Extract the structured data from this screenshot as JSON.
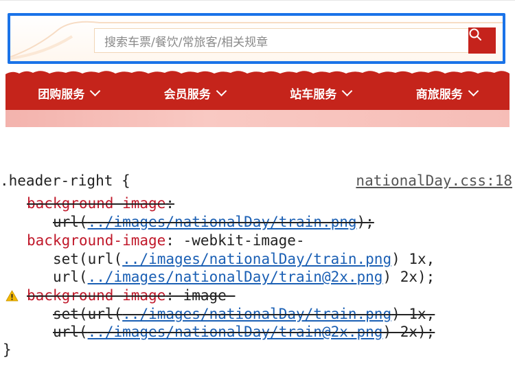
{
  "header": {
    "search_placeholder": "搜索车票/餐饮/常旅客/相关规章"
  },
  "nav": {
    "items": [
      {
        "label": "团购服务"
      },
      {
        "label": "会员服务"
      },
      {
        "label": "站车服务"
      },
      {
        "label": "商旅服务"
      }
    ]
  },
  "styles": {
    "selector": ".header-right",
    "open_brace": "{",
    "close_brace": "}",
    "source": "nationalDay.css:18",
    "rules": [
      {
        "prop": "background-image",
        "sep": ":",
        "overridden": true,
        "warning": false
      },
      {
        "prefix": "url(",
        "link": "../images/nationalDay/train.png",
        "suffix": ");",
        "overridden": true
      },
      {
        "prop": "background-image",
        "sep": ": -webkit-image-",
        "overridden": false
      },
      {
        "prefix": "set(url(",
        "link": "../images/nationalDay/train.png",
        "suffix": ") 1x,",
        "overridden": false
      },
      {
        "prefix": "url(",
        "link": "../images/nationalDay/train@2x.png",
        "suffix": ") 2x);",
        "overridden": false
      },
      {
        "prop": "background-image",
        "sep": ": image-",
        "overridden": true,
        "warning": true
      },
      {
        "prefix": "set(url(",
        "link": "../images/nationalDay/train.png",
        "suffix": ") 1x,",
        "overridden": true
      },
      {
        "prefix": "url(",
        "link": "../images/nationalDay/train@2x.png",
        "suffix": ") 2x);",
        "overridden": true
      }
    ]
  },
  "colors": {
    "nav_red": "#c5241b",
    "focus_outline": "#1a73e8",
    "property_red": "#c0182a",
    "link_blue": "#1a5fb4"
  }
}
